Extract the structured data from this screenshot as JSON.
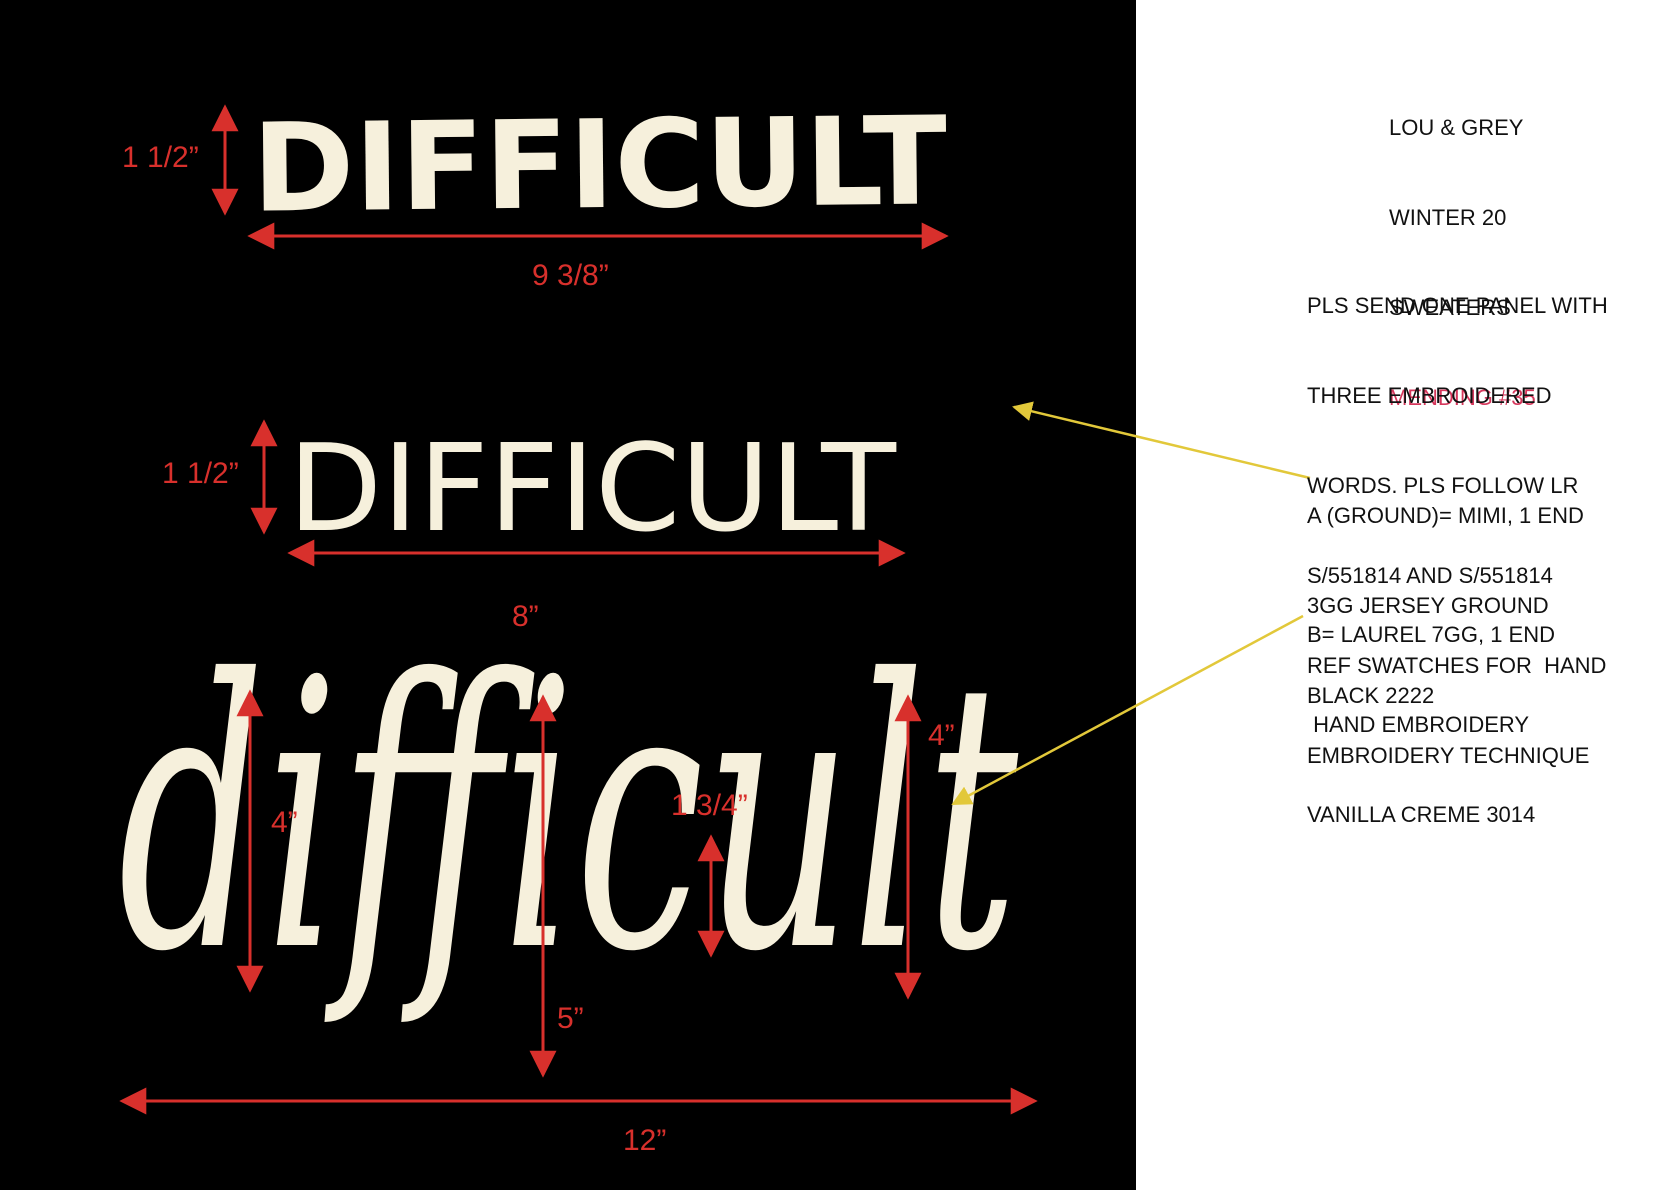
{
  "colors": {
    "panel": "#000000",
    "cream": "#f6f0dc",
    "dimension": "#d8302c",
    "leader": "#e2c83a",
    "note_text": "#111111",
    "highlight": "#d6375c"
  },
  "panel_words": {
    "word1": "DIFFICULT",
    "word2": "DIFFICULT",
    "word3": "difficult"
  },
  "dimensions": {
    "word1_height": "1 1/2”",
    "word1_width": "9 3/8”",
    "word2_height": "1 1/2”",
    "word2_width": "8”",
    "word3_ascender": "4”",
    "word3_descender": "5”",
    "word3_xheight": "1 3/4”",
    "word3_t_height": "4”",
    "word3_width": "12”"
  },
  "header": {
    "brand": "LOU & GREY",
    "season": "WINTER 20",
    "category": "SWEATERS",
    "mending": "MENDING #35"
  },
  "instructions": {
    "line1": "PLS SEND ONE PANEL WITH",
    "line2": "THREE EMBROIDERED",
    "line3": "WORDS. PLS FOLLOW LR",
    "line4": "S/551814 AND S/551814",
    "line5": "REF SWATCHES FOR  HAND",
    "line6": "EMBROIDERY TECHNIQUE"
  },
  "material_a": {
    "line1": "A (GROUND)= MIMI, 1 END",
    "line2": "3GG JERSEY GROUND",
    "line3": "BLACK 2222"
  },
  "material_b": {
    "line1": "B= LAUREL 7GG, 1 END",
    "line2": " HAND EMBROIDERY",
    "line3": "VANILLA CREME 3014"
  }
}
